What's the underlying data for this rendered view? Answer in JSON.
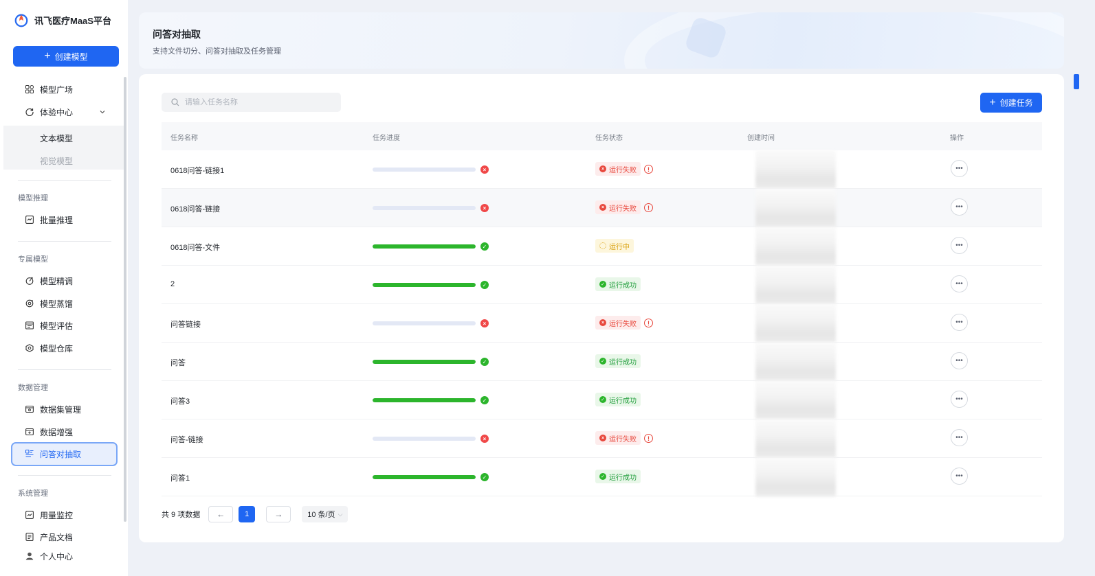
{
  "app": {
    "name": "讯飞医疗MaaS平台"
  },
  "sidebar": {
    "create_button": "创建模型",
    "items": [
      {
        "label": "模型广场",
        "icon": "grid-icon"
      },
      {
        "label": "体验中心",
        "icon": "refresh-icon"
      }
    ],
    "sub_items": [
      {
        "label": "文本模型"
      },
      {
        "label": "视觉模型"
      }
    ],
    "groups": [
      {
        "title": "模型推理",
        "items": [
          {
            "label": "批量推理",
            "icon": "batch-icon"
          }
        ]
      },
      {
        "title": "专属模型",
        "items": [
          {
            "label": "模型精调",
            "icon": "tune-icon"
          },
          {
            "label": "模型蒸馏",
            "icon": "distill-icon"
          },
          {
            "label": "模型评估",
            "icon": "evaluate-icon"
          },
          {
            "label": "模型仓库",
            "icon": "warehouse-icon"
          }
        ]
      },
      {
        "title": "数据管理",
        "items": [
          {
            "label": "数据集管理",
            "icon": "dataset-icon"
          },
          {
            "label": "数据增强",
            "icon": "augment-icon"
          },
          {
            "label": "问答对抽取",
            "icon": "qa-extract-icon"
          }
        ]
      },
      {
        "title": "系统管理",
        "items": [
          {
            "label": "用量监控",
            "icon": "monitor-icon"
          },
          {
            "label": "产品文档",
            "icon": "doc-icon"
          },
          {
            "label": "个人中心",
            "icon": "user-icon"
          }
        ]
      }
    ]
  },
  "header": {
    "title": "问答对抽取",
    "subtitle": "支持文件切分、问答对抽取及任务管理"
  },
  "toolbar": {
    "search_placeholder": "请输入任务名称",
    "create_task": "创建任务"
  },
  "table": {
    "columns": [
      "任务名称",
      "任务进度",
      "任务状态",
      "创建时间",
      "操作"
    ],
    "rows": [
      {
        "name": "0618问答-链接1",
        "progress": 0,
        "progress_state": "fail",
        "status": "运行失败",
        "status_type": "fail"
      },
      {
        "name": "0618问答-链接",
        "progress": 0,
        "progress_state": "fail",
        "status": "运行失败",
        "status_type": "fail"
      },
      {
        "name": "0618问答-文件",
        "progress": 100,
        "progress_state": "ok",
        "status": "运行中",
        "status_type": "run"
      },
      {
        "name": "2",
        "progress": 100,
        "progress_state": "ok",
        "status": "运行成功",
        "status_type": "ok"
      },
      {
        "name": "问答链接",
        "progress": 0,
        "progress_state": "fail",
        "status": "运行失败",
        "status_type": "fail"
      },
      {
        "name": "问答",
        "progress": 100,
        "progress_state": "ok",
        "status": "运行成功",
        "status_type": "ok"
      },
      {
        "name": "问答3",
        "progress": 100,
        "progress_state": "ok",
        "status": "运行成功",
        "status_type": "ok"
      },
      {
        "name": "问答-链接",
        "progress": 0,
        "progress_state": "fail",
        "status": "运行失败",
        "status_type": "fail"
      },
      {
        "name": "问答1",
        "progress": 100,
        "progress_state": "ok",
        "status": "运行成功",
        "status_type": "ok"
      }
    ]
  },
  "pagination": {
    "total": "共 9 项数据",
    "current_page": "1",
    "page_size": "10 条/页"
  },
  "colors": {
    "primary": "#1f66f2",
    "success": "#2cb52c",
    "danger": "#e8483d",
    "warning": "#d9a111"
  }
}
